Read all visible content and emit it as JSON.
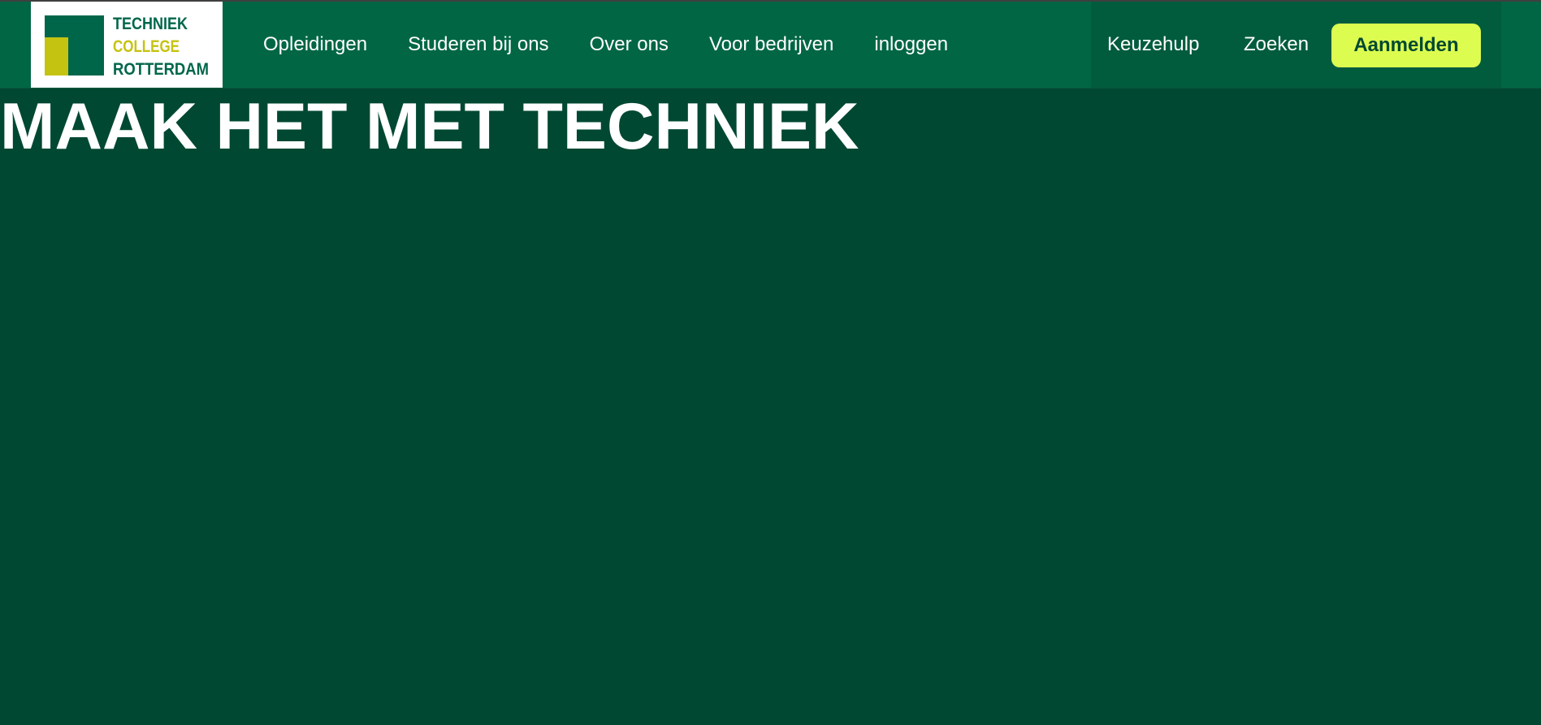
{
  "logo": {
    "line1": "TECHNIEK",
    "line2": "COLLEGE",
    "line3": "ROTTERDAM",
    "icon": "logo-t-icon"
  },
  "nav": {
    "items": [
      {
        "label": "Opleidingen"
      },
      {
        "label": "Studeren bij ons"
      },
      {
        "label": "Over ons"
      },
      {
        "label": "Voor bedrijven"
      },
      {
        "label": "inloggen"
      }
    ],
    "right": {
      "keuzehulp": "Keuzehulp",
      "zoeken": "Zoeken",
      "cta": "Aanmelden"
    }
  },
  "hero": {
    "title": "MAAK HET MET TECHNIEK"
  },
  "colors": {
    "header_green": "#006644",
    "page_green": "#004832",
    "accent_lime": "#dcfc4f",
    "logo_dark_green": "#00664a",
    "logo_yellow": "#c5c312"
  }
}
